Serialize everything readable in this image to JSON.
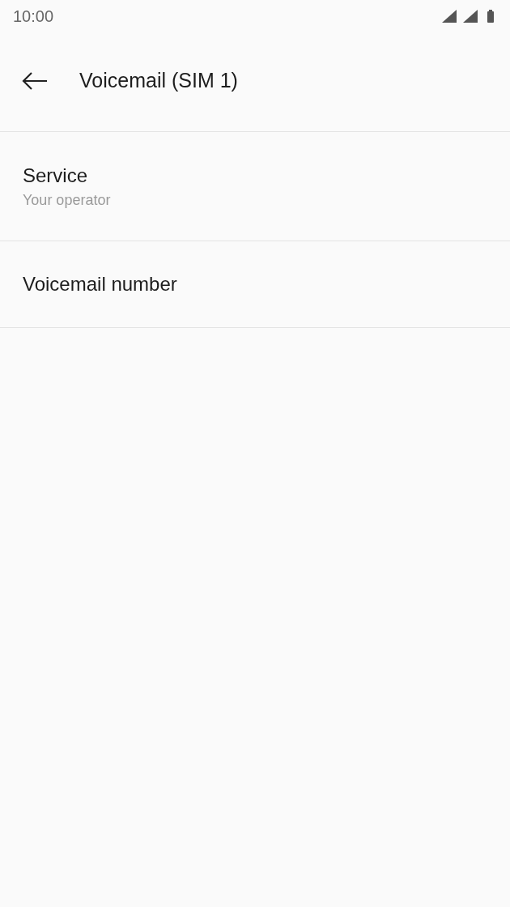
{
  "status_bar": {
    "time": "10:00"
  },
  "app_bar": {
    "title": "Voicemail (SIM 1)"
  },
  "settings": [
    {
      "title": "Service",
      "summary": "Your operator"
    },
    {
      "title": "Voicemail number"
    }
  ]
}
